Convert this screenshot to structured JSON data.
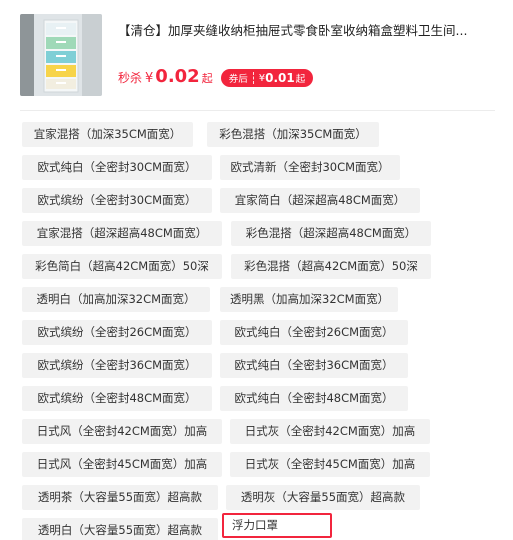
{
  "product": {
    "title": "【清仓】加厚夹缝收纳柜抽屉式零食卧室收纳箱盒塑料卫生间...",
    "seckill_label": "秒杀",
    "currency": "¥",
    "price": "0.02",
    "price_suffix": "起",
    "coupon": {
      "label": "券后",
      "currency": "¥",
      "price": "0.01",
      "suffix": "起"
    },
    "thumb_drawer_colors": [
      "#f7d44a",
      "#7fcfd6",
      "#9fd9b8",
      "#f2eee0",
      "#e8f1f4"
    ]
  },
  "options": [
    "宜家混搭（加深35CM面宽）",
    "彩色混搭（加深35CM面宽）",
    "欧式纯白（全密封30CM面宽）",
    "欧式清新（全密封30CM面宽）",
    "欧式缤纷（全密封30CM面宽）",
    "宜家简白（超深超高48CM面宽）",
    "宜家混搭（超深超高48CM面宽）",
    "彩色混搭（超深超高48CM面宽）",
    "彩色简白（超高42CM面宽）50深",
    "彩色混搭（超高42CM面宽）50深",
    "透明白（加高加深32CM面宽）",
    "透明黑（加高加深32CM面宽）",
    "欧式缤纷（全密封26CM面宽）",
    "欧式纯白（全密封26CM面宽）",
    "欧式缤纷（全密封36CM面宽）",
    "欧式纯白（全密封36CM面宽）",
    "欧式缤纷（全密封48CM面宽）",
    "欧式纯白（全密封48CM面宽）",
    "日式风（全密封42CM面宽）加高",
    "日式灰（全密封42CM面宽）加高",
    "日式风（全密封45CM面宽）加高",
    "日式灰（全密封45CM面宽）加高",
    "透明茶（大容量55面宽）超高款",
    "透明灰（大容量55面宽）超高款",
    "透明白（大容量55面宽）超高款",
    "浮力口罩"
  ],
  "selected_option": "浮力口罩",
  "accent_color": "#f2253d"
}
